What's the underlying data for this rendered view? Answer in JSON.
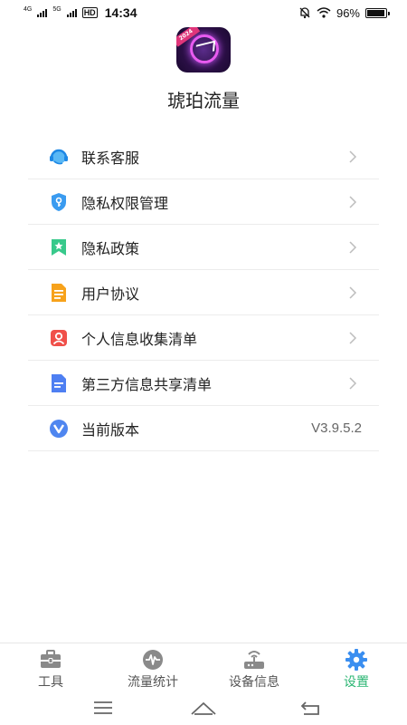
{
  "status_bar": {
    "network_1": "4G",
    "network_2": "5G",
    "hd": "HD",
    "time": "14:34",
    "battery": "96%"
  },
  "app": {
    "title": "琥珀流量",
    "logo_badge": "2024"
  },
  "menu": [
    {
      "label": "联系客服",
      "icon": "headset-icon"
    },
    {
      "label": "隐私权限管理",
      "icon": "shield-key-icon"
    },
    {
      "label": "隐私政策",
      "icon": "bookmark-star-icon"
    },
    {
      "label": "用户协议",
      "icon": "document-icon"
    },
    {
      "label": "个人信息收集清单",
      "icon": "person-icon"
    },
    {
      "label": "第三方信息共享清单",
      "icon": "file-list-icon"
    },
    {
      "label": "当前版本",
      "icon": "version-v-icon",
      "value": "V3.9.5.2"
    }
  ],
  "bottom_nav": [
    {
      "label": "工具",
      "icon": "toolbox-icon"
    },
    {
      "label": "流量统计",
      "icon": "pulse-icon"
    },
    {
      "label": "设备信息",
      "icon": "router-icon"
    },
    {
      "label": "设置",
      "icon": "gear-icon",
      "active": true
    }
  ],
  "colors": {
    "accent_active": "#2bb673",
    "settings_gear": "#3a8ef0"
  }
}
